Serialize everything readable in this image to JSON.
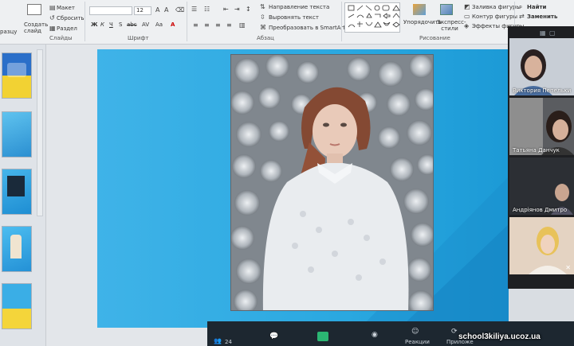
{
  "ribbon": {
    "slide_group": {
      "new_slide": "Создать слайд",
      "layout": "Макет",
      "reset": "Сбросить",
      "section": "Раздел",
      "label": "Слайды",
      "left_cut": "разцу"
    },
    "font_group": {
      "size": "12",
      "buttons": [
        "Ж",
        "К",
        "Ч",
        "S",
        "abc",
        "AV",
        "Aa",
        "A"
      ],
      "label": "Шрифт"
    },
    "paragraph_group": {
      "text_direction": "Направление текста",
      "align_text": "Выровнять текст",
      "smartart": "Преобразовать в SmartArt",
      "label": "Абзац"
    },
    "drawing_group": {
      "arrange": "Упорядочить",
      "quick_styles": "Экспресс-стили",
      "shape_fill": "Заливка фигуры",
      "shape_outline": "Контур фигуры",
      "shape_effects": "Эффекты фигуры",
      "label": "Рисование"
    },
    "editing_group": {
      "find": "Найти",
      "replace": "Заменить"
    }
  },
  "zoom_panel": {
    "participants": [
      {
        "name": "Виктория Пепельки"
      },
      {
        "name": "Татьяна Данчук"
      },
      {
        "name": "Андріянов Дмитро"
      },
      {
        "name": ""
      }
    ]
  },
  "taskbar": {
    "count": "24",
    "reactions": "Реакции",
    "apps": "Приложе"
  },
  "watermark": "school3kiliya.ucoz.ua",
  "colors": {
    "slide_bg": "#2aa8e0",
    "zoom_bg": "#1e1f22",
    "taskbar_bg": "#1d2730"
  }
}
